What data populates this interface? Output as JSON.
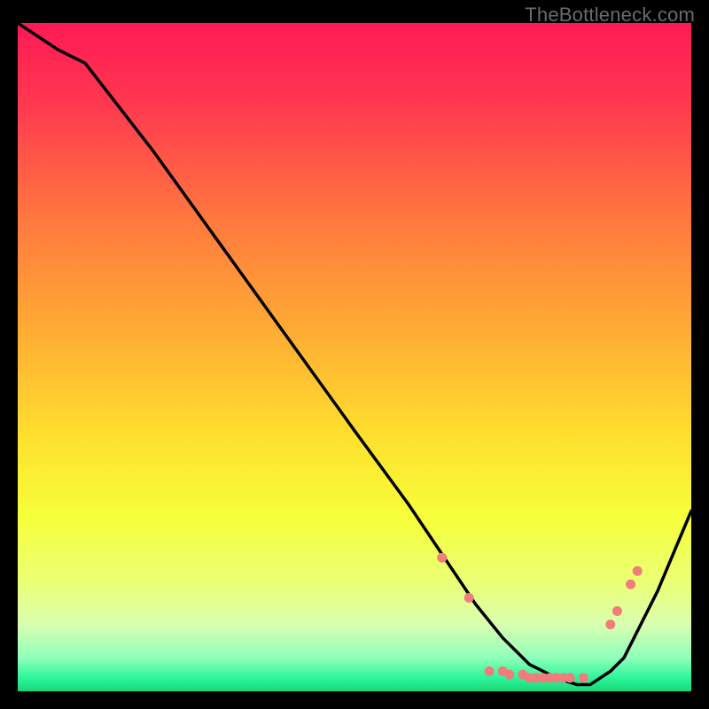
{
  "watermark": "TheBottleneck.com",
  "colors": {
    "background": "#000000",
    "curve": "#000000",
    "marker": "#f17c7c",
    "watermark_text": "#6a6a6a"
  },
  "chart_data": {
    "type": "line",
    "title": "",
    "xlabel": "",
    "ylabel": "",
    "xlim": [
      0,
      100
    ],
    "ylim": [
      0,
      100
    ],
    "gradient_stops": [
      {
        "offset": 0,
        "color": "#ff1a55"
      },
      {
        "offset": 12,
        "color": "#ff3850"
      },
      {
        "offset": 30,
        "color": "#ff7a3e"
      },
      {
        "offset": 48,
        "color": "#ffb233"
      },
      {
        "offset": 62,
        "color": "#ffe02e"
      },
      {
        "offset": 74,
        "color": "#f6ff3a"
      },
      {
        "offset": 84,
        "color": "#eaff77"
      },
      {
        "offset": 90,
        "color": "#d9ffb0"
      },
      {
        "offset": 95,
        "color": "#8fffba"
      },
      {
        "offset": 98,
        "color": "#2cf59a"
      },
      {
        "offset": 100,
        "color": "#17d877"
      }
    ],
    "series": [
      {
        "name": "bottleneck-curve",
        "x": [
          0,
          6,
          10,
          20,
          30,
          40,
          50,
          58,
          64,
          68,
          72,
          76,
          80,
          83,
          85,
          88,
          90,
          95,
          100
        ],
        "y": [
          100,
          96,
          94,
          81,
          67,
          53,
          39,
          28,
          19,
          13,
          8,
          4,
          2,
          1,
          1,
          3,
          5,
          15,
          27
        ]
      }
    ],
    "markers": {
      "name": "highlighted-points",
      "points": [
        {
          "x": 63,
          "y": 20
        },
        {
          "x": 67,
          "y": 14
        },
        {
          "x": 70,
          "y": 3
        },
        {
          "x": 72,
          "y": 3
        },
        {
          "x": 73,
          "y": 2.5
        },
        {
          "x": 75,
          "y": 2.5
        },
        {
          "x": 76,
          "y": 2
        },
        {
          "x": 77,
          "y": 2
        },
        {
          "x": 78,
          "y": 2
        },
        {
          "x": 79,
          "y": 2
        },
        {
          "x": 80,
          "y": 2
        },
        {
          "x": 81,
          "y": 2
        },
        {
          "x": 82,
          "y": 2
        },
        {
          "x": 84,
          "y": 2
        },
        {
          "x": 88,
          "y": 10
        },
        {
          "x": 89,
          "y": 12
        },
        {
          "x": 91,
          "y": 16
        },
        {
          "x": 92,
          "y": 18
        }
      ]
    }
  }
}
